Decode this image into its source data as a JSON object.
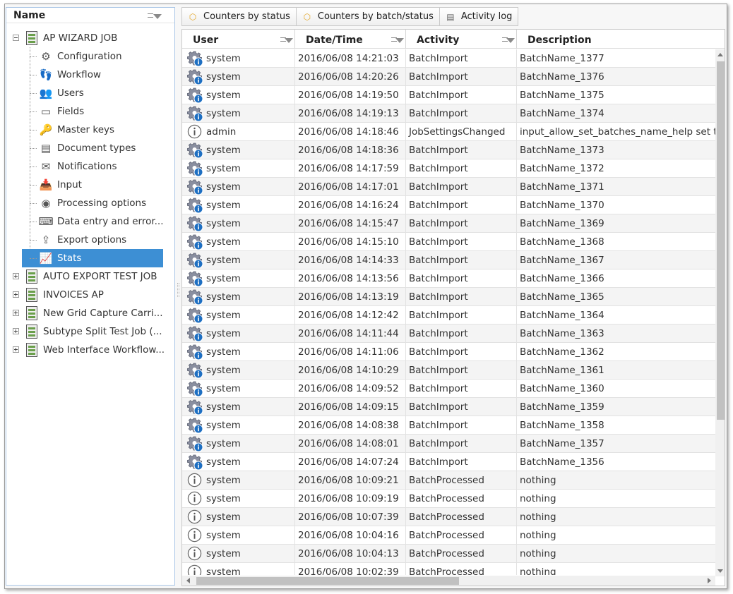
{
  "tree": {
    "header": "Name",
    "jobs": [
      {
        "label": "AP WIZARD JOB",
        "expanded": true
      },
      {
        "label": "AUTO EXPORT TEST JOB",
        "expanded": false
      },
      {
        "label": "INVOICES AP",
        "expanded": false
      },
      {
        "label": "New Grid Capture Carri...",
        "expanded": false
      },
      {
        "label": "Subtype Split Test Job (...",
        "expanded": false
      },
      {
        "label": "Web Interface Workflow...",
        "expanded": false
      }
    ],
    "children": [
      {
        "label": "Configuration",
        "icon": "gear-icon"
      },
      {
        "label": "Workflow",
        "icon": "footprints-icon"
      },
      {
        "label": "Users",
        "icon": "users-icon"
      },
      {
        "label": "Fields",
        "icon": "field-icon"
      },
      {
        "label": "Master keys",
        "icon": "key-icon"
      },
      {
        "label": "Document types",
        "icon": "document-icon"
      },
      {
        "label": "Notifications",
        "icon": "envelope-icon"
      },
      {
        "label": "Input",
        "icon": "inbox-icon"
      },
      {
        "label": "Processing options",
        "icon": "processing-icon"
      },
      {
        "label": "Data entry and error...",
        "icon": "keyboard-icon"
      },
      {
        "label": "Export options",
        "icon": "export-icon"
      },
      {
        "label": "Stats",
        "icon": "chart-icon",
        "selected": true
      }
    ]
  },
  "tabs": [
    {
      "label": "Counters by status",
      "icon": "cube-icon"
    },
    {
      "label": "Counters by batch/status",
      "icon": "cube-icon"
    },
    {
      "label": "Activity log",
      "icon": "log-icon"
    }
  ],
  "grid": {
    "columns": [
      "User",
      "Date/Time",
      "Activity",
      "Description"
    ],
    "rows": [
      {
        "icon": "gear",
        "user": "system",
        "date": "2016/06/08 14:21:03",
        "activity": "BatchImport",
        "description": "BatchName_1377"
      },
      {
        "icon": "gear",
        "user": "system",
        "date": "2016/06/08 14:20:26",
        "activity": "BatchImport",
        "description": "BatchName_1376"
      },
      {
        "icon": "gear",
        "user": "system",
        "date": "2016/06/08 14:19:50",
        "activity": "BatchImport",
        "description": "BatchName_1375"
      },
      {
        "icon": "gear",
        "user": "system",
        "date": "2016/06/08 14:19:13",
        "activity": "BatchImport",
        "description": "BatchName_1374"
      },
      {
        "icon": "info",
        "user": "admin",
        "date": "2016/06/08 14:18:46",
        "activity": "JobSettingsChanged",
        "description": "input_allow_set_batches_name_help set t"
      },
      {
        "icon": "gear",
        "user": "system",
        "date": "2016/06/08 14:18:36",
        "activity": "BatchImport",
        "description": "BatchName_1373"
      },
      {
        "icon": "gear",
        "user": "system",
        "date": "2016/06/08 14:17:59",
        "activity": "BatchImport",
        "description": "BatchName_1372"
      },
      {
        "icon": "gear",
        "user": "system",
        "date": "2016/06/08 14:17:01",
        "activity": "BatchImport",
        "description": "BatchName_1371"
      },
      {
        "icon": "gear",
        "user": "system",
        "date": "2016/06/08 14:16:24",
        "activity": "BatchImport",
        "description": "BatchName_1370"
      },
      {
        "icon": "gear",
        "user": "system",
        "date": "2016/06/08 14:15:47",
        "activity": "BatchImport",
        "description": "BatchName_1369"
      },
      {
        "icon": "gear",
        "user": "system",
        "date": "2016/06/08 14:15:10",
        "activity": "BatchImport",
        "description": "BatchName_1368"
      },
      {
        "icon": "gear",
        "user": "system",
        "date": "2016/06/08 14:14:33",
        "activity": "BatchImport",
        "description": "BatchName_1367"
      },
      {
        "icon": "gear",
        "user": "system",
        "date": "2016/06/08 14:13:56",
        "activity": "BatchImport",
        "description": "BatchName_1366"
      },
      {
        "icon": "gear",
        "user": "system",
        "date": "2016/06/08 14:13:19",
        "activity": "BatchImport",
        "description": "BatchName_1365"
      },
      {
        "icon": "gear",
        "user": "system",
        "date": "2016/06/08 14:12:42",
        "activity": "BatchImport",
        "description": "BatchName_1364"
      },
      {
        "icon": "gear",
        "user": "system",
        "date": "2016/06/08 14:11:44",
        "activity": "BatchImport",
        "description": "BatchName_1363"
      },
      {
        "icon": "gear",
        "user": "system",
        "date": "2016/06/08 14:11:06",
        "activity": "BatchImport",
        "description": "BatchName_1362"
      },
      {
        "icon": "gear",
        "user": "system",
        "date": "2016/06/08 14:10:29",
        "activity": "BatchImport",
        "description": "BatchName_1361"
      },
      {
        "icon": "gear",
        "user": "system",
        "date": "2016/06/08 14:09:52",
        "activity": "BatchImport",
        "description": "BatchName_1360"
      },
      {
        "icon": "gear",
        "user": "system",
        "date": "2016/06/08 14:09:15",
        "activity": "BatchImport",
        "description": "BatchName_1359"
      },
      {
        "icon": "gear",
        "user": "system",
        "date": "2016/06/08 14:08:38",
        "activity": "BatchImport",
        "description": "BatchName_1358"
      },
      {
        "icon": "gear",
        "user": "system",
        "date": "2016/06/08 14:08:01",
        "activity": "BatchImport",
        "description": "BatchName_1357"
      },
      {
        "icon": "gear",
        "user": "system",
        "date": "2016/06/08 14:07:24",
        "activity": "BatchImport",
        "description": "BatchName_1356"
      },
      {
        "icon": "info",
        "user": "system",
        "date": "2016/06/08 10:09:21",
        "activity": "BatchProcessed",
        "description": "nothing"
      },
      {
        "icon": "info",
        "user": "system",
        "date": "2016/06/08 10:09:19",
        "activity": "BatchProcessed",
        "description": "nothing"
      },
      {
        "icon": "info",
        "user": "system",
        "date": "2016/06/08 10:07:39",
        "activity": "BatchProcessed",
        "description": "nothing"
      },
      {
        "icon": "info",
        "user": "system",
        "date": "2016/06/08 10:04:16",
        "activity": "BatchProcessed",
        "description": "nothing"
      },
      {
        "icon": "info",
        "user": "system",
        "date": "2016/06/08 10:04:13",
        "activity": "BatchProcessed",
        "description": "nothing"
      },
      {
        "icon": "info",
        "user": "system",
        "date": "2016/06/08 10:02:39",
        "activity": "BatchProcessed",
        "description": "nothing"
      }
    ]
  },
  "colors": {
    "selection": "#3d8fd4",
    "info_blue": "#1e6fc2",
    "panel_border": "#a9c6e6"
  }
}
